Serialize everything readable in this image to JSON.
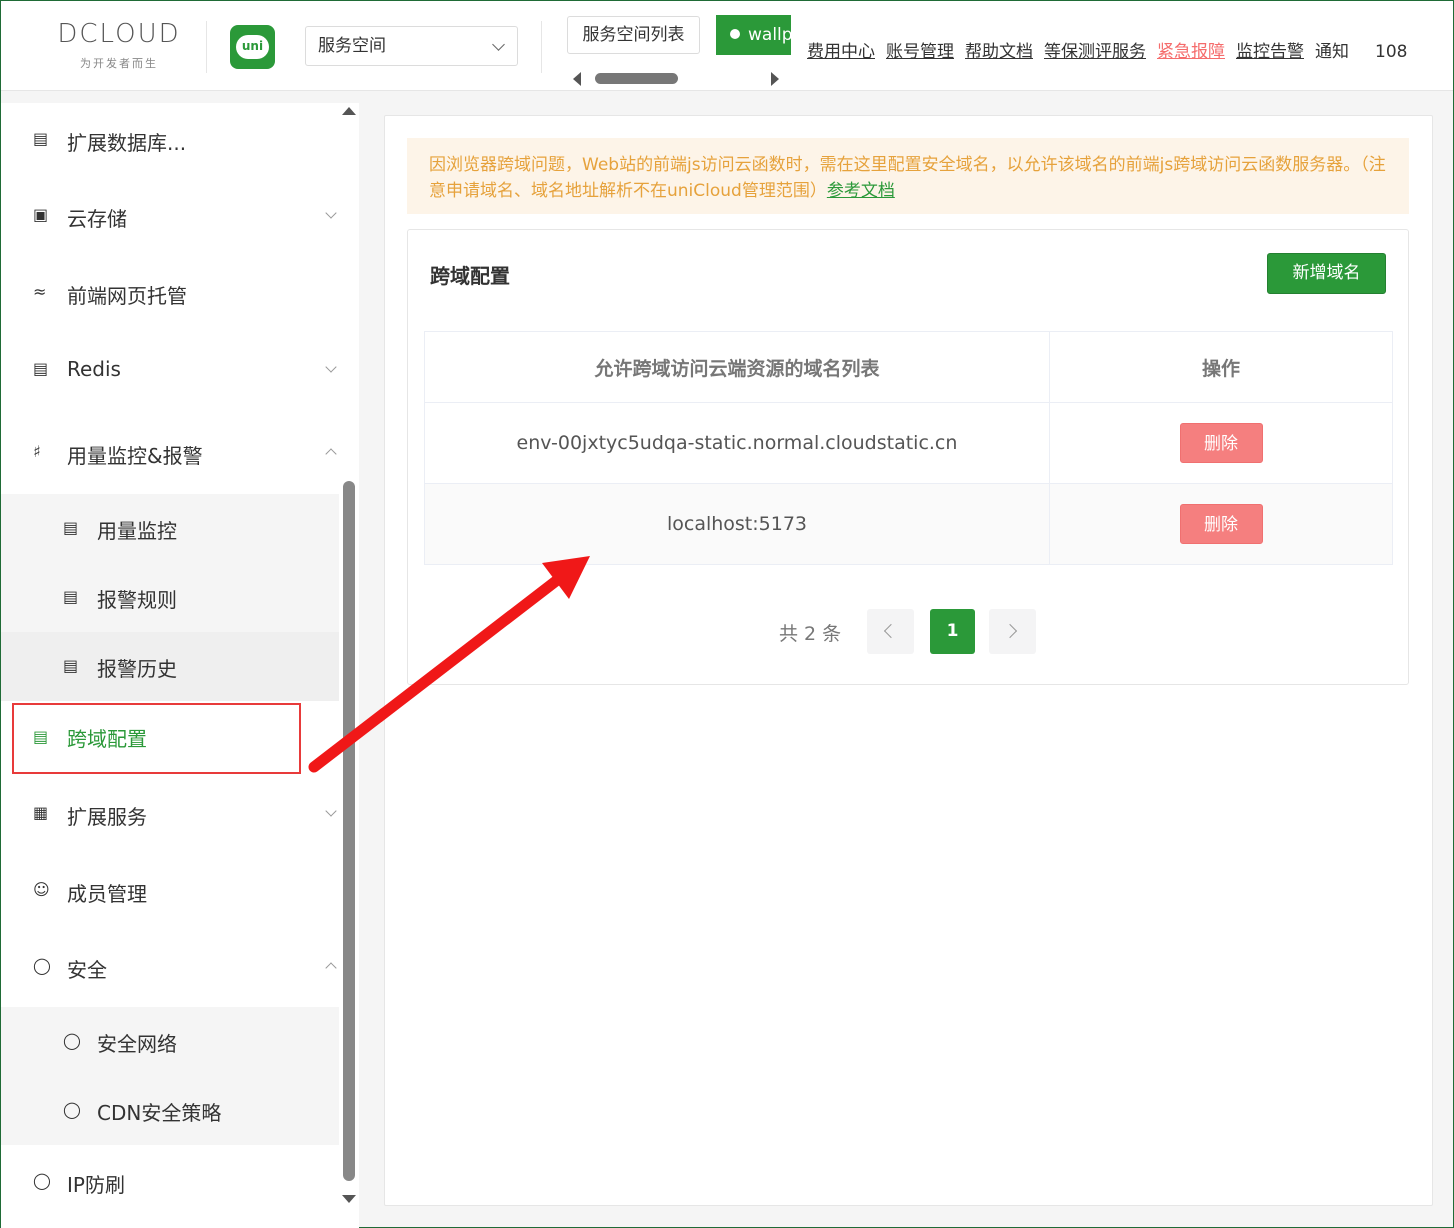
{
  "header": {
    "logo_text": "DCLOUD",
    "slogan": "为开发者而生",
    "uni_icon_label": "uni",
    "space_select": "服务空间",
    "space_list_button": "服务空间列表",
    "active_space_tab": "wallp",
    "nav": [
      {
        "label": "费用中心"
      },
      {
        "label": "账号管理"
      },
      {
        "label": "帮助文档"
      },
      {
        "label": "等保测评服务"
      },
      {
        "label": "紧急报障",
        "color": "#f56c6c"
      },
      {
        "label": "监控告警"
      },
      {
        "label": "通知"
      },
      {
        "label": "108"
      }
    ]
  },
  "sidebar": {
    "items": [
      {
        "label": "扩展数据库...",
        "icon": "database-icon"
      },
      {
        "label": "云存储",
        "icon": "storage-icon"
      },
      {
        "label": "前端网页托管",
        "icon": "hosting-icon"
      },
      {
        "label": "Redis",
        "icon": "redis-icon"
      },
      {
        "label": "用量监控&报警",
        "icon": "alarm-icon"
      },
      {
        "label": "用量监控",
        "icon": "monitor-icon"
      },
      {
        "label": "报警规则",
        "icon": "rule-icon"
      },
      {
        "label": "报警历史",
        "icon": "history-icon"
      },
      {
        "label": "跨域配置",
        "icon": "cors-icon",
        "active": true
      },
      {
        "label": "扩展服务",
        "icon": "grid-icon"
      },
      {
        "label": "成员管理",
        "icon": "user-icon"
      },
      {
        "label": "安全",
        "icon": "shield-icon"
      },
      {
        "label": "安全网络",
        "icon": "shield-icon"
      },
      {
        "label": "CDN安全策略",
        "icon": "shield-icon"
      },
      {
        "label": "IP防刷",
        "icon": "shield-check-icon"
      }
    ]
  },
  "notice": {
    "text": "因浏览器跨域问题，Web站的前端js访问云函数时，需在这里配置安全域名，以允许该域名的前端js跨域访问云函数服务器。（注意申请域名、域名地址解析不在uniCloud管理范围）",
    "link": "参考文档"
  },
  "card": {
    "title": "跨域配置",
    "add_button": "新增域名",
    "columns": [
      "允许跨域访问云端资源的域名列表",
      "操作"
    ],
    "rows": [
      {
        "domain": "env-00jxtyc5udqa-static.normal.cloudstatic.cn",
        "action": "删除"
      },
      {
        "domain": "localhost:5173",
        "action": "删除"
      }
    ]
  },
  "pagination": {
    "total_text": "共 2 条",
    "current_page": "1"
  },
  "colors": {
    "brand_green": "#2b9939",
    "danger": "#f57f7f",
    "annotation_red": "#e83a3a",
    "notice_text": "#e6a23c"
  }
}
